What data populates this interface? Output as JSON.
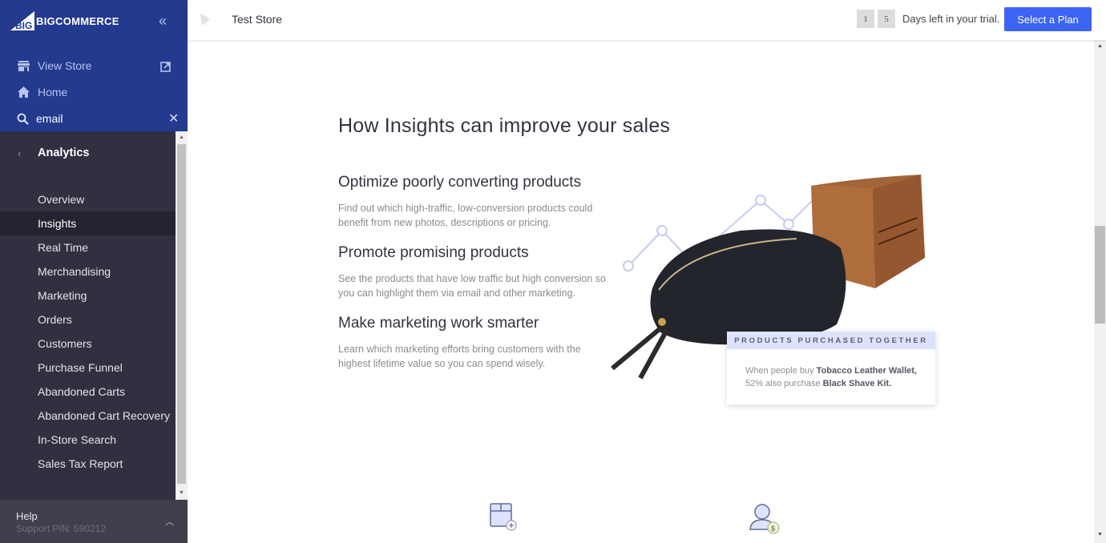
{
  "sidebar": {
    "brand": "BIGCOMMERCE",
    "view_store": "View Store",
    "home": "Home",
    "search_value": "email",
    "section_title": "Analytics",
    "items": [
      {
        "label": "Overview",
        "active": false
      },
      {
        "label": "Insights",
        "active": true
      },
      {
        "label": "Real Time",
        "active": false
      },
      {
        "label": "Merchandising",
        "active": false
      },
      {
        "label": "Marketing",
        "active": false
      },
      {
        "label": "Orders",
        "active": false
      },
      {
        "label": "Customers",
        "active": false
      },
      {
        "label": "Purchase Funnel",
        "active": false
      },
      {
        "label": "Abandoned Carts",
        "active": false
      },
      {
        "label": "Abandoned Cart Recovery",
        "active": false
      },
      {
        "label": "In-Store Search",
        "active": false
      },
      {
        "label": "Sales Tax Report",
        "active": false
      }
    ],
    "help": {
      "label": "Help",
      "support_pin": "Support PIN: 590212"
    }
  },
  "header": {
    "store_name": "Test Store",
    "trial_days": [
      "1",
      "5"
    ],
    "trial_text": "Days left in your trial.",
    "select_plan": "Select a Plan"
  },
  "main": {
    "title": "How Insights can improve your sales",
    "features": [
      {
        "heading": "Optimize poorly converting products",
        "body": "Find out which high-traffic, low-conversion products could benefit from new photos, descriptions or pricing."
      },
      {
        "heading": "Promote promising products",
        "body": "See the products that have low traffic but high conversion so you can highlight them via email and other marketing."
      },
      {
        "heading": "Make marketing work smarter",
        "body": "Learn which marketing efforts bring customers with the highest lifetime value so you can spend wisely."
      }
    ],
    "callout": {
      "header": "PRODUCTS PURCHASED TOGETHER",
      "prefix": "When people buy ",
      "product_a": "Tobacco Leather Wallet,",
      "middle": "52% also purchase ",
      "product_b": "Black Shave Kit."
    }
  },
  "colors": {
    "sidebar_top": "#233a8e",
    "sidebar_nav": "#313040",
    "accent": "#3c64f4"
  }
}
